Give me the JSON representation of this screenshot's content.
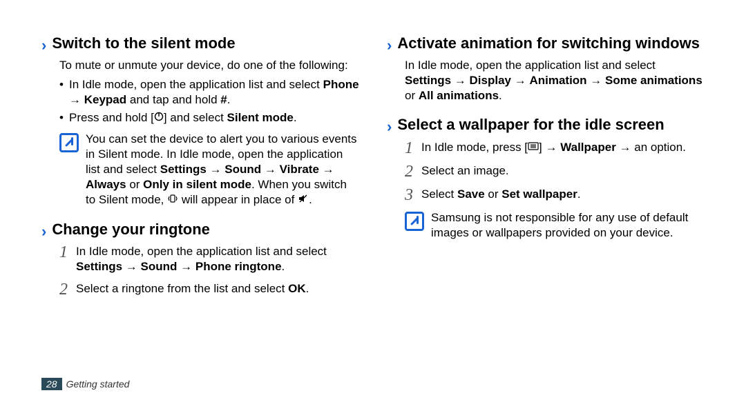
{
  "left": {
    "section1": {
      "heading": "Switch to the silent mode",
      "intro": "To mute or unmute your device, do one of the following:",
      "bullets": [
        {
          "pre": "In Idle mode, open the application list and select ",
          "bold1": "Phone",
          "arrow1": " → ",
          "bold2": "Keypad",
          "post": " and tap and hold ",
          "bold3": "#",
          "end": "."
        },
        {
          "pre": "Press and hold [",
          "icon": "power",
          "post": "] and select ",
          "bold1": "Silent mode",
          "end": "."
        }
      ],
      "note": {
        "pre": "You can set the device to alert you to various events in Silent mode. In Idle mode, open the application list and select ",
        "bold1": "Settings",
        "arrow1": " → ",
        "bold2": "Sound",
        "arrow2": " → ",
        "bold3": "Vibrate",
        "arrow3": " → ",
        "bold4": "Always",
        "mid1": " or ",
        "bold5": "Only in silent mode",
        "mid2": ". When you switch to Silent mode, ",
        "icon1": "vibrate",
        "mid3": " will appear in place of ",
        "icon2": "mute",
        "end": "."
      }
    },
    "section2": {
      "heading": "Change your ringtone",
      "steps": [
        {
          "num": "1",
          "pre": "In Idle mode, open the application list and select ",
          "bold1": "Settings",
          "arrow1": " → ",
          "bold2": "Sound",
          "arrow2": " → ",
          "bold3": "Phone ringtone",
          "end": "."
        },
        {
          "num": "2",
          "pre": "Select a ringtone from the list and select ",
          "bold1": "OK",
          "end": "."
        }
      ]
    }
  },
  "right": {
    "section1": {
      "heading": "Activate animation for switching windows",
      "para": {
        "pre": "In Idle mode, open the application list and select ",
        "bold1": "Settings",
        "arrow1": " → ",
        "bold2": "Display",
        "arrow2": " → ",
        "bold3": "Animation",
        "arrow3": " → ",
        "bold4": "Some animations",
        "mid": " or ",
        "bold5": "All animations",
        "end": "."
      }
    },
    "section2": {
      "heading": "Select a wallpaper for the idle screen",
      "steps": [
        {
          "num": "1",
          "pre": "In Idle mode, press [",
          "icon": "menu",
          "post": "] → ",
          "bold1": "Wallpaper",
          "mid": " → an option.",
          "end": ""
        },
        {
          "num": "2",
          "pre": "Select an image.",
          "end": ""
        },
        {
          "num": "3",
          "pre": "Select ",
          "bold1": "Save",
          "mid": " or ",
          "bold2": "Set wallpaper",
          "end": "."
        }
      ],
      "note": "Samsung is not responsible for any use of default images or wallpapers provided on your device."
    }
  },
  "footer": {
    "page": "28",
    "chapter": "Getting started"
  }
}
